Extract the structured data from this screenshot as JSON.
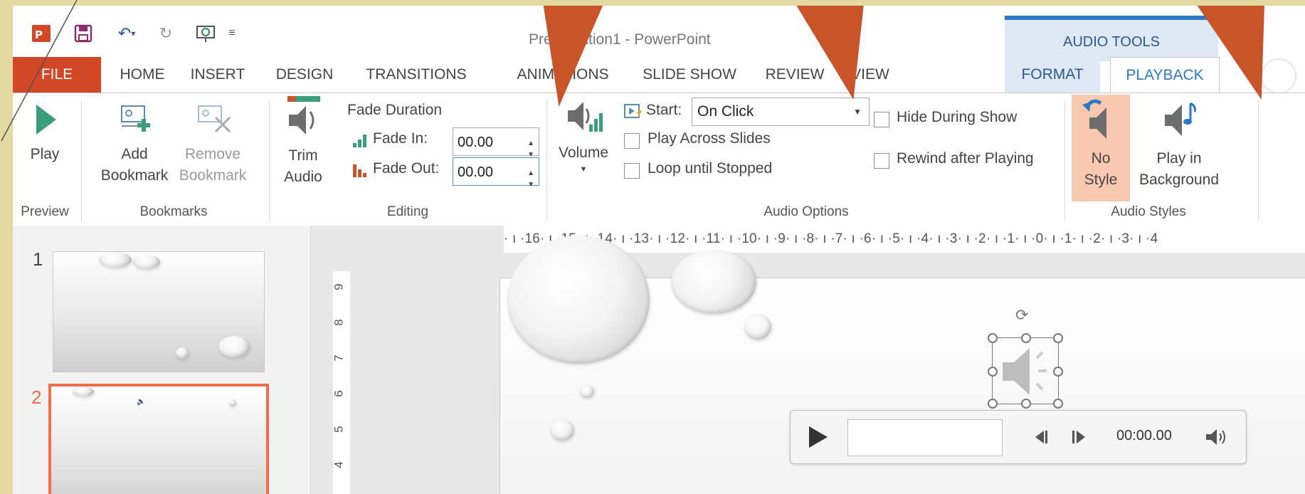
{
  "window": {
    "title": "Presentation1 - PowerPoint"
  },
  "context_tab": {
    "label": "AUDIO TOOLS"
  },
  "tabs": [
    "FILE",
    "HOME",
    "INSERT",
    "DESIGN",
    "TRANSITIONS",
    "ANIMATIONS",
    "SLIDE SHOW",
    "REVIEW",
    "VIEW",
    "FORMAT",
    "PLAYBACK"
  ],
  "groups": {
    "preview": {
      "label": "Preview",
      "play": "Play"
    },
    "bookmarks": {
      "label": "Bookmarks",
      "add_line1": "Add",
      "add_line2": "Bookmark",
      "remove_line1": "Remove",
      "remove_line2": "Bookmark"
    },
    "editing": {
      "label": "Editing",
      "trim_line1": "Trim",
      "trim_line2": "Audio",
      "fade_duration": "Fade Duration",
      "fade_in_label": "Fade In:",
      "fade_in_value": "00.00",
      "fade_out_label": "Fade Out:",
      "fade_out_value": "00.00"
    },
    "audio_options": {
      "label": "Audio Options",
      "volume": "Volume",
      "start_label": "Start:",
      "start_value": "On Click",
      "play_across": "Play Across Slides",
      "loop": "Loop until Stopped",
      "hide": "Hide During Show",
      "rewind": "Rewind after Playing"
    },
    "audio_styles": {
      "label": "Audio Styles",
      "no_style_line1": "No",
      "no_style_line2": "Style",
      "bg_line1": "Play in",
      "bg_line2": "Background"
    }
  },
  "ruler": {
    "horizontal": "· ı ·16· ı ·15· ı ·14· ı ·13· ı ·12· ı ·11· ı ·10· ı ·9· ı ·8· ı ·7· ı ·6· ı ·5· ı ·4· ı ·3· ı ·2· ı ·1· ı ·0· ı ·1· ı ·2· ı ·3· ı ·4",
    "vertical": [
      "9",
      "8",
      "7",
      "6",
      "5",
      "4"
    ]
  },
  "slides": [
    "1",
    "2"
  ],
  "player": {
    "time": "00:00.00"
  },
  "colors": {
    "file_tab": "#d24726",
    "context_accent": "#2b78c5",
    "selection": "#f06e4c",
    "callout_arrow": "#c8542a"
  }
}
